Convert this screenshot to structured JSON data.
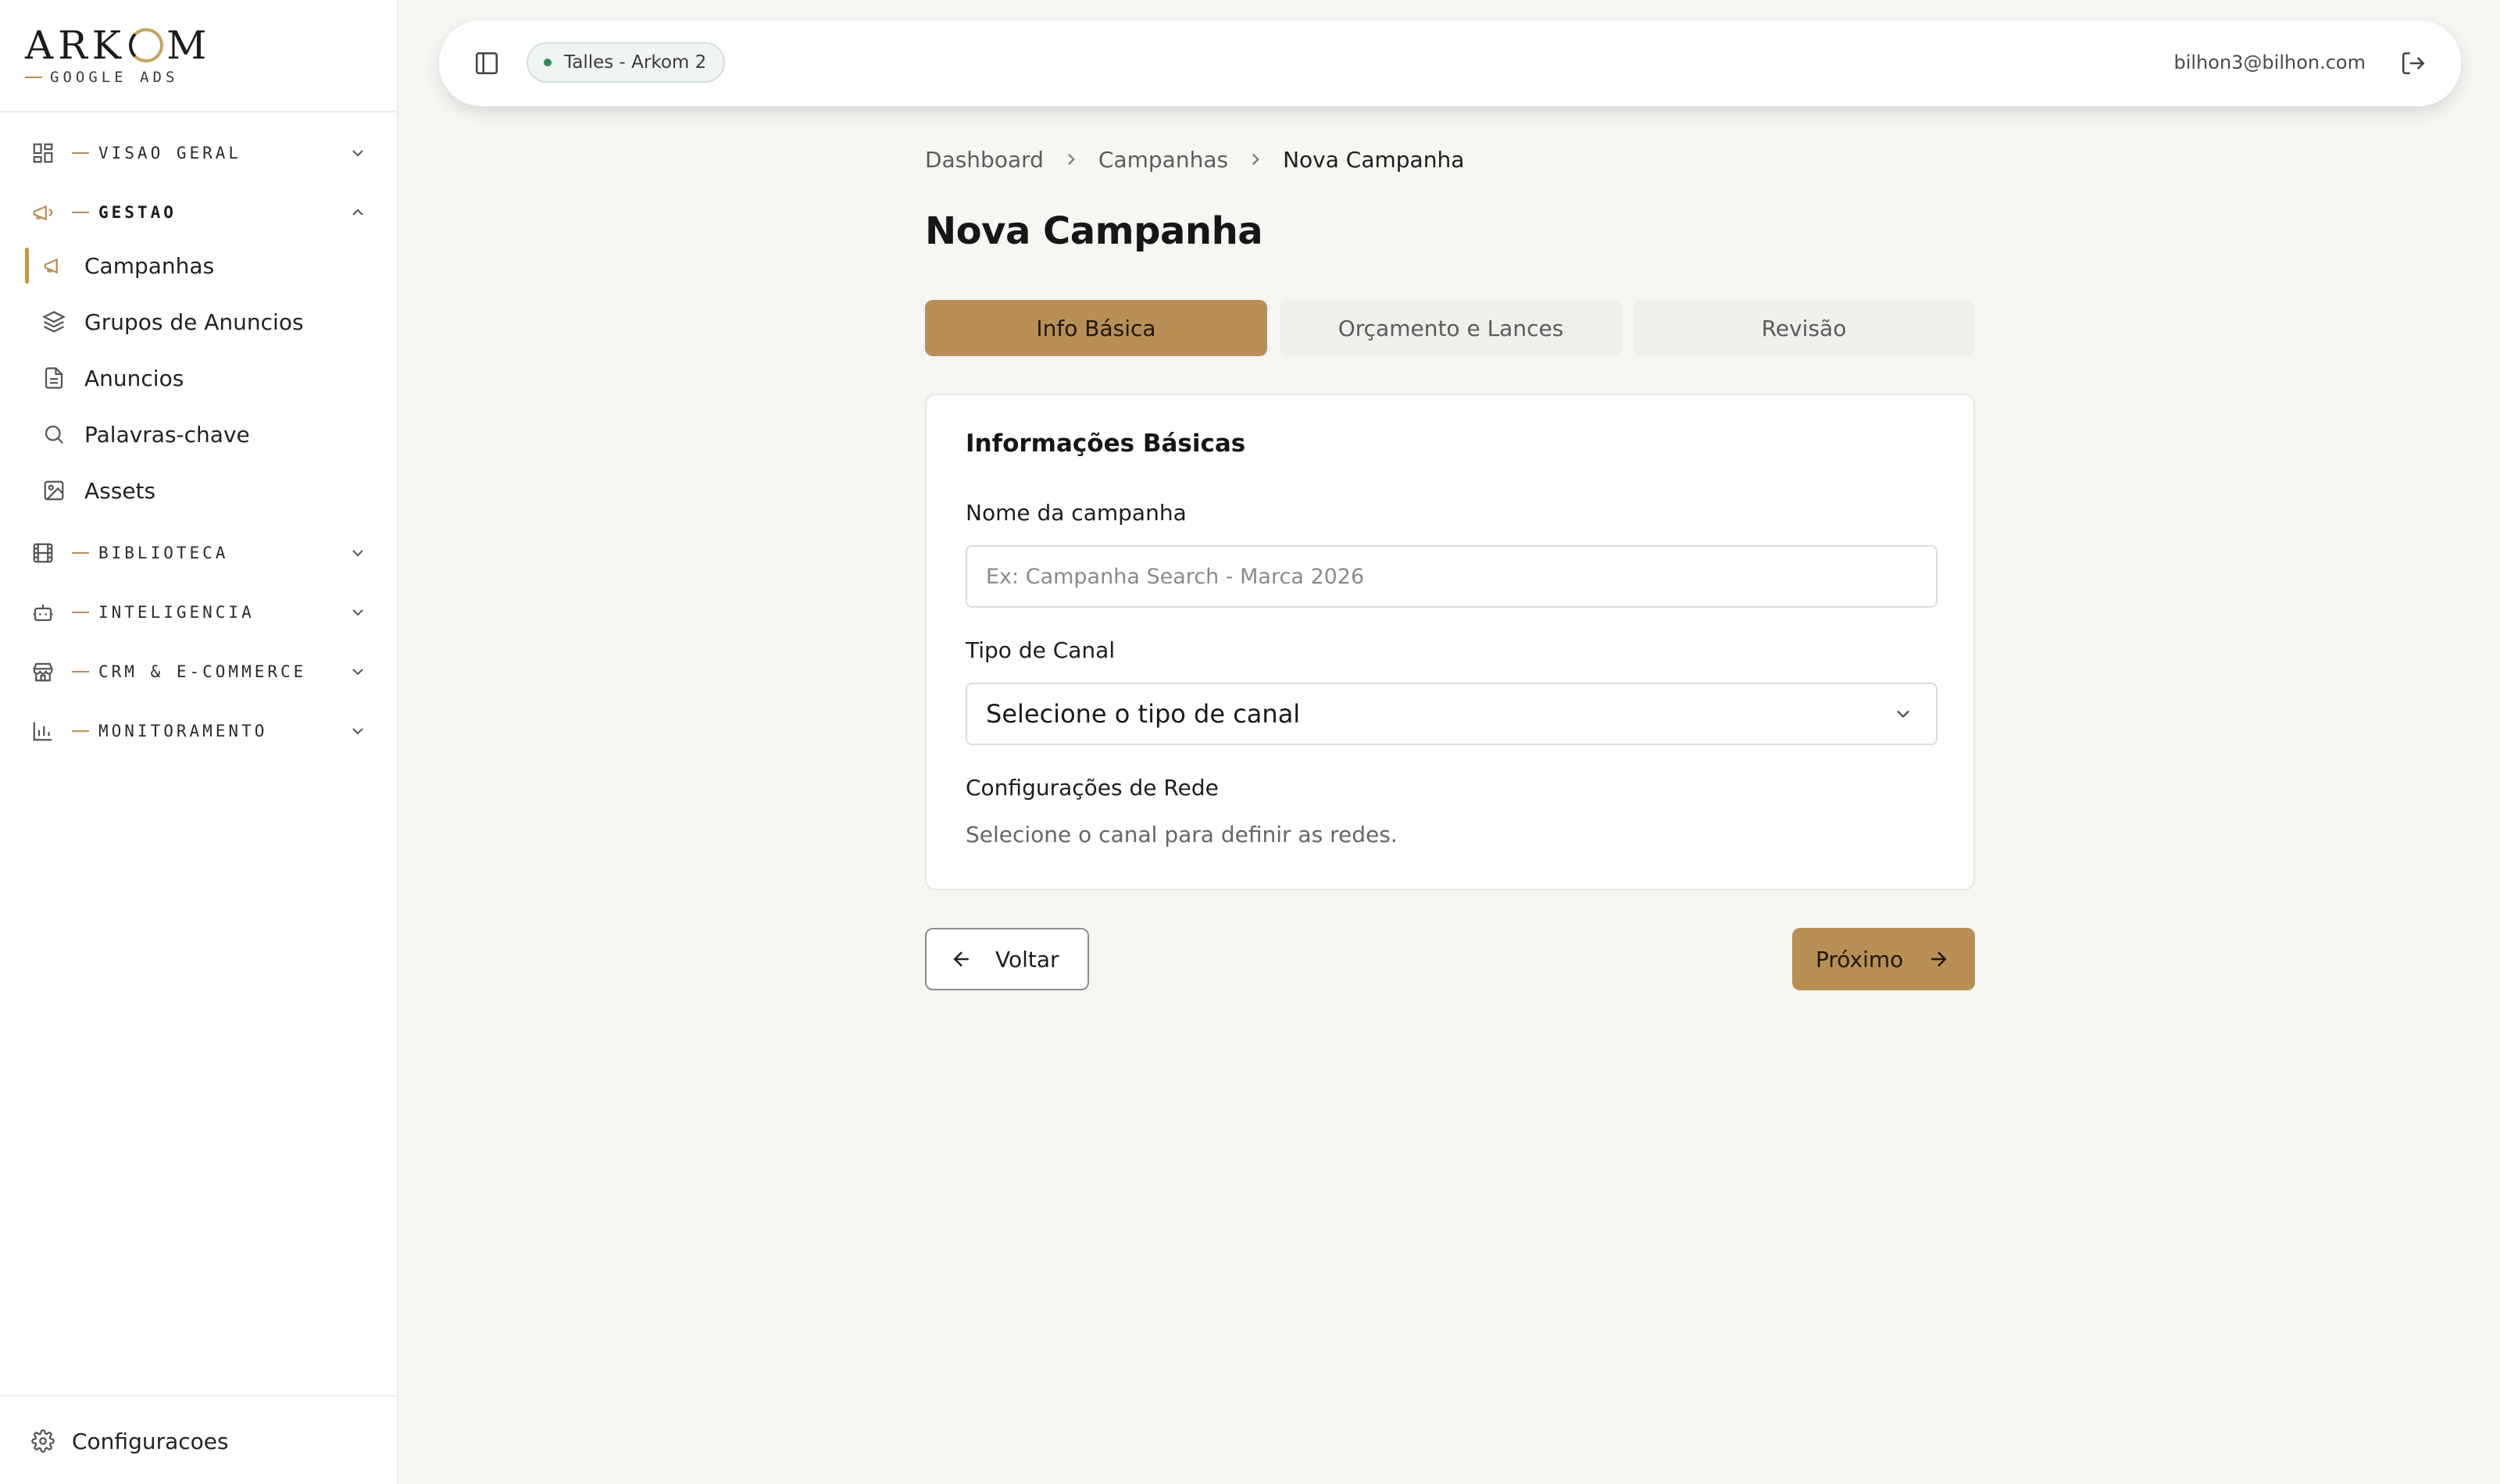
{
  "brand": {
    "logo_left": "ARK",
    "logo_right": "M",
    "subtitle": "GOOGLE ADS",
    "accent_color": "#b88f55"
  },
  "sidebar": {
    "sections": [
      {
        "label": "VISAO GERAL",
        "icon": "layout-grid-icon",
        "expanded": false
      },
      {
        "label": "GESTAO",
        "icon": "megaphone-icon",
        "expanded": true
      },
      {
        "label": "BIBLIOTECA",
        "icon": "film-icon",
        "expanded": false
      },
      {
        "label": "INTELIGENCIA",
        "icon": "bot-icon",
        "expanded": false
      },
      {
        "label": "CRM & E-COMMERCE",
        "icon": "store-icon",
        "expanded": false
      },
      {
        "label": "MONITORAMENTO",
        "icon": "bar-chart-icon",
        "expanded": false
      }
    ],
    "gestao_items": [
      {
        "label": "Campanhas",
        "icon": "megaphone-icon",
        "active": true
      },
      {
        "label": "Grupos de Anuncios",
        "icon": "layers-icon",
        "active": false
      },
      {
        "label": "Anuncios",
        "icon": "file-text-icon",
        "active": false
      },
      {
        "label": "Palavras-chave",
        "icon": "search-icon",
        "active": false
      },
      {
        "label": "Assets",
        "icon": "image-icon",
        "active": false
      }
    ],
    "settings_label": "Configuracoes"
  },
  "topbar": {
    "account_label": "Talles - Arkom 2",
    "account_status_color": "#2e8b57",
    "user_email": "bilhon3@bilhon.com"
  },
  "breadcrumb": [
    "Dashboard",
    "Campanhas",
    "Nova Campanha"
  ],
  "page_title": "Nova Campanha",
  "steps": [
    {
      "label": "Info Básica",
      "active": true
    },
    {
      "label": "Orçamento e Lances",
      "active": false
    },
    {
      "label": "Revisão",
      "active": false
    }
  ],
  "form": {
    "title": "Informações Básicas",
    "name_label": "Nome da campanha",
    "name_value": "",
    "name_placeholder": "Ex: Campanha Search - Marca 2026",
    "channel_label": "Tipo de Canal",
    "channel_value": "Selecione o tipo de canal",
    "network_label": "Configurações de Rede",
    "network_helper": "Selecione o canal para definir as redes."
  },
  "actions": {
    "back_label": "Voltar",
    "next_label": "Próximo"
  }
}
